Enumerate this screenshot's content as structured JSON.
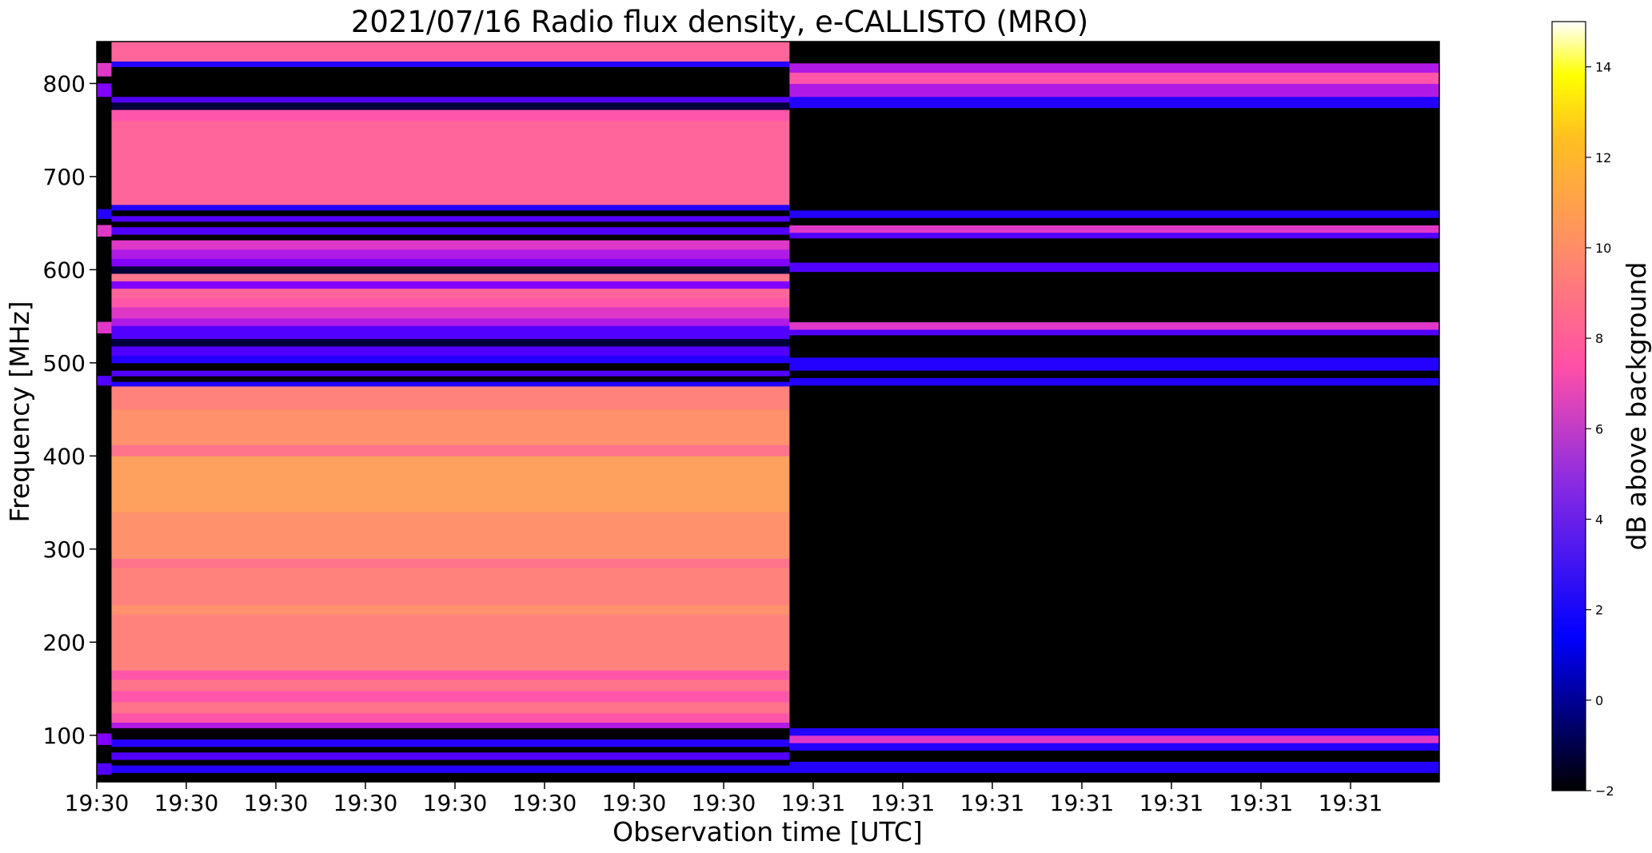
{
  "chart_data": {
    "type": "heatmap",
    "title": "2021/07/16  Radio flux density, e-CALLISTO (MRO)",
    "xlabel": "Observation time [UTC]",
    "ylabel": "Frequency [MHz]",
    "colorbar_label": "dB above background",
    "colormap": "gnuplot2",
    "x_ticks": [
      "19:30",
      "19:30",
      "19:30",
      "19:30",
      "19:30",
      "19:30",
      "19:30",
      "19:30",
      "19:31",
      "19:31",
      "19:31",
      "19:31",
      "19:31",
      "19:31",
      "19:31"
    ],
    "ylim": [
      50,
      845
    ],
    "y_ticks": [
      100,
      200,
      300,
      400,
      500,
      600,
      700,
      800
    ],
    "colorbar_range": [
      -2,
      15
    ],
    "colorbar_ticks": [
      -2,
      0,
      2,
      4,
      6,
      8,
      10,
      12,
      14
    ],
    "segments": [
      {
        "time_range_fraction": [
          0.0,
          0.011
        ],
        "bands": [
          {
            "f": [
              50,
              845
            ],
            "db": -2
          },
          {
            "f": [
              808,
              822
            ],
            "db": 7
          },
          {
            "f": [
              786,
              800
            ],
            "db": 5
          },
          {
            "f": [
              636,
              648
            ],
            "db": 7
          },
          {
            "f": [
              655,
              665
            ],
            "db": 3
          },
          {
            "f": [
              532,
              544
            ],
            "db": 7
          },
          {
            "f": [
              476,
              486
            ],
            "db": 4
          },
          {
            "f": [
              90,
              102
            ],
            "db": 5
          },
          {
            "f": [
              58,
              70
            ],
            "db": 4
          }
        ]
      },
      {
        "time_range_fraction": [
          0.011,
          0.516
        ],
        "bands": [
          {
            "f": [
              50,
              60
            ],
            "db": -2
          },
          {
            "f": [
              60,
              68
            ],
            "db": 3
          },
          {
            "f": [
              68,
              74
            ],
            "db": -2
          },
          {
            "f": [
              74,
              82
            ],
            "db": 4
          },
          {
            "f": [
              82,
              88
            ],
            "db": -2
          },
          {
            "f": [
              88,
              96
            ],
            "db": 3
          },
          {
            "f": [
              96,
              108
            ],
            "db": -2
          },
          {
            "f": [
              108,
              114
            ],
            "db": 6
          },
          {
            "f": [
              114,
              124
            ],
            "db": 8
          },
          {
            "f": [
              124,
              136
            ],
            "db": 9
          },
          {
            "f": [
              136,
              148
            ],
            "db": 8
          },
          {
            "f": [
              148,
              160
            ],
            "db": 9
          },
          {
            "f": [
              160,
              170
            ],
            "db": 8
          },
          {
            "f": [
              170,
              230
            ],
            "db": 9.5
          },
          {
            "f": [
              230,
              240
            ],
            "db": 10
          },
          {
            "f": [
              240,
              280
            ],
            "db": 9.5
          },
          {
            "f": [
              280,
              290
            ],
            "db": 9
          },
          {
            "f": [
              290,
              340
            ],
            "db": 10
          },
          {
            "f": [
              340,
              400
            ],
            "db": 10.5
          },
          {
            "f": [
              400,
              412
            ],
            "db": 9
          },
          {
            "f": [
              412,
              450
            ],
            "db": 10
          },
          {
            "f": [
              450,
              475
            ],
            "db": 9.5
          },
          {
            "f": [
              475,
              480
            ],
            "db": 3
          },
          {
            "f": [
              480,
              486
            ],
            "db": -2
          },
          {
            "f": [
              486,
              492
            ],
            "db": 4
          },
          {
            "f": [
              492,
              500
            ],
            "db": -2
          },
          {
            "f": [
              500,
              508
            ],
            "db": 3
          },
          {
            "f": [
              508,
              518
            ],
            "db": 4
          },
          {
            "f": [
              518,
              526
            ],
            "db": -1
          },
          {
            "f": [
              526,
              540
            ],
            "db": 4
          },
          {
            "f": [
              540,
              548
            ],
            "db": 6
          },
          {
            "f": [
              548,
              560
            ],
            "db": 7
          },
          {
            "f": [
              560,
              570
            ],
            "db": 8
          },
          {
            "f": [
              570,
              580
            ],
            "db": 8.5
          },
          {
            "f": [
              580,
              588
            ],
            "db": 5
          },
          {
            "f": [
              588,
              596
            ],
            "db": 9
          },
          {
            "f": [
              596,
              604
            ],
            "db": -1
          },
          {
            "f": [
              604,
              612
            ],
            "db": 5
          },
          {
            "f": [
              612,
              622
            ],
            "db": 6
          },
          {
            "f": [
              622,
              632
            ],
            "db": 7
          },
          {
            "f": [
              632,
              638
            ],
            "db": -2
          },
          {
            "f": [
              638,
              646
            ],
            "db": 4
          },
          {
            "f": [
              646,
              652
            ],
            "db": -2
          },
          {
            "f": [
              652,
              658
            ],
            "db": 4
          },
          {
            "f": [
              658,
              664
            ],
            "db": -2
          },
          {
            "f": [
              664,
              670
            ],
            "db": 3
          },
          {
            "f": [
              670,
              760
            ],
            "db": 8.5
          },
          {
            "f": [
              760,
              772
            ],
            "db": 8
          },
          {
            "f": [
              772,
              780
            ],
            "db": -1
          },
          {
            "f": [
              780,
              786
            ],
            "db": 4
          },
          {
            "f": [
              786,
              818
            ],
            "db": -2
          },
          {
            "f": [
              818,
              824
            ],
            "db": 3
          },
          {
            "f": [
              824,
              845
            ],
            "db": 8.5
          }
        ]
      },
      {
        "time_range_fraction": [
          0.516,
          1.0
        ],
        "bands": [
          {
            "f": [
              50,
              60
            ],
            "db": -2
          },
          {
            "f": [
              60,
              72
            ],
            "db": 3
          },
          {
            "f": [
              72,
              84
            ],
            "db": -2
          },
          {
            "f": [
              84,
              92
            ],
            "db": 3
          },
          {
            "f": [
              92,
              100
            ],
            "db": 7
          },
          {
            "f": [
              100,
              108
            ],
            "db": 3
          },
          {
            "f": [
              108,
              476
            ],
            "db": -2
          },
          {
            "f": [
              476,
              484
            ],
            "db": 3
          },
          {
            "f": [
              484,
              492
            ],
            "db": -2
          },
          {
            "f": [
              492,
              506
            ],
            "db": 3
          },
          {
            "f": [
              506,
              530
            ],
            "db": -2
          },
          {
            "f": [
              530,
              536
            ],
            "db": 4
          },
          {
            "f": [
              536,
              544
            ],
            "db": 7
          },
          {
            "f": [
              544,
              598
            ],
            "db": -2
          },
          {
            "f": [
              598,
              608
            ],
            "db": 4
          },
          {
            "f": [
              608,
              634
            ],
            "db": -2
          },
          {
            "f": [
              634,
              640
            ],
            "db": 4
          },
          {
            "f": [
              640,
              648
            ],
            "db": 7
          },
          {
            "f": [
              648,
              656
            ],
            "db": -2
          },
          {
            "f": [
              656,
              664
            ],
            "db": 3
          },
          {
            "f": [
              664,
              774
            ],
            "db": -2
          },
          {
            "f": [
              774,
              786
            ],
            "db": 3
          },
          {
            "f": [
              786,
              800
            ],
            "db": 6
          },
          {
            "f": [
              800,
              812
            ],
            "db": 8
          },
          {
            "f": [
              812,
              822
            ],
            "db": 6
          },
          {
            "f": [
              822,
              845
            ],
            "db": -2
          }
        ]
      }
    ]
  }
}
